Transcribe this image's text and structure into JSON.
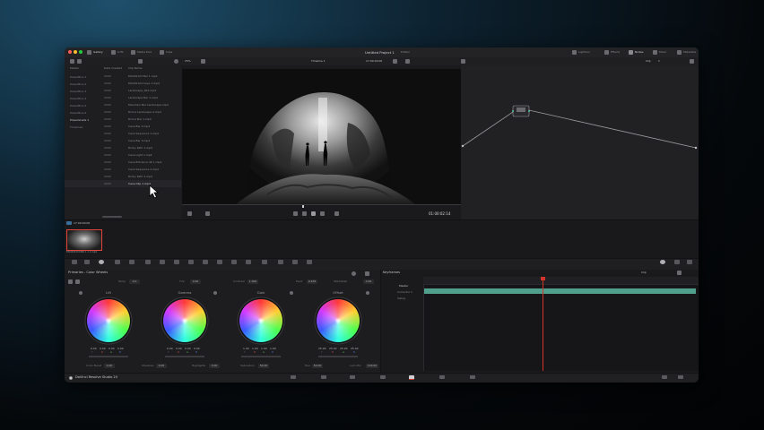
{
  "app": {
    "title": "Untitled Project 1",
    "edited": "Edited",
    "name": "DaVinci Resolve Studio 20"
  },
  "toolbar": {
    "gallery": "Gallery",
    "luts": "LUTs",
    "media_pool": "Media Pool",
    "clips": "Clips",
    "zoom": "15%",
    "timeline_name": "Timeline 1",
    "timecode_top": "17:00:00:00",
    "node_mode": "Clip"
  },
  "header_right": {
    "lightbox": "Lightbox",
    "effects": "Effects",
    "nodes": "Nodes",
    "metadata": "Metadata",
    "mixer": "Mixer",
    "clip_num": "1"
  },
  "media_pool": {
    "header_bins": "Master",
    "col_date": "Date Created",
    "col_name": "Clip Name",
    "bins": [
      "PowerBins 1",
      "PowerBins 2",
      "PowerBins 3",
      "PowerBins 4",
      "PowerBins 5",
      "PowerBins 6",
      "PowerGrade 1",
      "Timelines"
    ],
    "rows": [
      {
        "date": "2025",
        "name": "DSC00123 Bar 1.mp4"
      },
      {
        "date": "2025",
        "name": "DSC00124 Cave 1.mp4"
      },
      {
        "date": "2025",
        "name": "Landscape_001.mp4"
      },
      {
        "date": "2025",
        "name": "Landscape Bar 1.mp4"
      },
      {
        "date": "2025",
        "name": "Mountain Bar Landscape.mp4"
      },
      {
        "date": "2025",
        "name": "Drone Landscape A.mp4"
      },
      {
        "date": "2025",
        "name": "Drone Bar 1.mp4"
      },
      {
        "date": "2025",
        "name": "Cave Bar 2.mp4"
      },
      {
        "date": "2025",
        "name": "Cave Sequence 1.mp4"
      },
      {
        "date": "2025",
        "name": "Cave Bar 3.mp4"
      },
      {
        "date": "2025",
        "name": "Rocky Path 1.mp4"
      },
      {
        "date": "2025",
        "name": "Cave Light 1.mp4"
      },
      {
        "date": "2025",
        "name": "Cave Entrance 4K 1.mp4"
      },
      {
        "date": "2025",
        "name": "Cave Sequence 2.mp4"
      },
      {
        "date": "2025",
        "name": "Rocky Path 2.mp4"
      },
      {
        "date": "2025",
        "name": "Cave Clip 1.mp4"
      }
    ]
  },
  "viewer": {
    "timecode": "01:00:02:14"
  },
  "clip_strip": {
    "clip_tc": "17:00:00:00",
    "clip_name": "DSC00123.MP4 1 1 1.mp4"
  },
  "color": {
    "panel_title": "Primaries - Color Wheels",
    "params_top": [
      {
        "label": "Temp",
        "value": "0.0"
      },
      {
        "label": "Tint",
        "value": "0.00"
      },
      {
        "label": "Contrast",
        "value": "1.000"
      },
      {
        "label": "Pivot",
        "value": "0.435"
      },
      {
        "label": "Mid/Detail",
        "value": "0.00"
      }
    ],
    "wheels": [
      {
        "label": "Lift",
        "values": [
          "0.00",
          "0.00",
          "0.00",
          "0.00"
        ]
      },
      {
        "label": "Gamma",
        "values": [
          "0.00",
          "0.00",
          "0.00",
          "0.00"
        ]
      },
      {
        "label": "Gain",
        "values": [
          "1.00",
          "1.00",
          "1.00",
          "1.00"
        ]
      },
      {
        "label": "Offset",
        "values": [
          "25.00",
          "25.00",
          "25.00",
          "25.00"
        ]
      }
    ],
    "channels": [
      "Y",
      "R",
      "G",
      "B"
    ],
    "params_bottom": [
      {
        "label": "Color Boost",
        "value": "0.00"
      },
      {
        "label": "Shadows",
        "value": "0.00"
      },
      {
        "label": "Highlights",
        "value": "0.00"
      },
      {
        "label": "Saturation",
        "value": "50.00"
      },
      {
        "label": "Hue",
        "value": "50.00"
      },
      {
        "label": "Lum Mix",
        "value": "100.00"
      }
    ]
  },
  "keyframes": {
    "title": "Keyframes",
    "mode": "Clip",
    "master": "Master",
    "tracks": [
      "Corrector 1",
      "Sizing"
    ]
  }
}
